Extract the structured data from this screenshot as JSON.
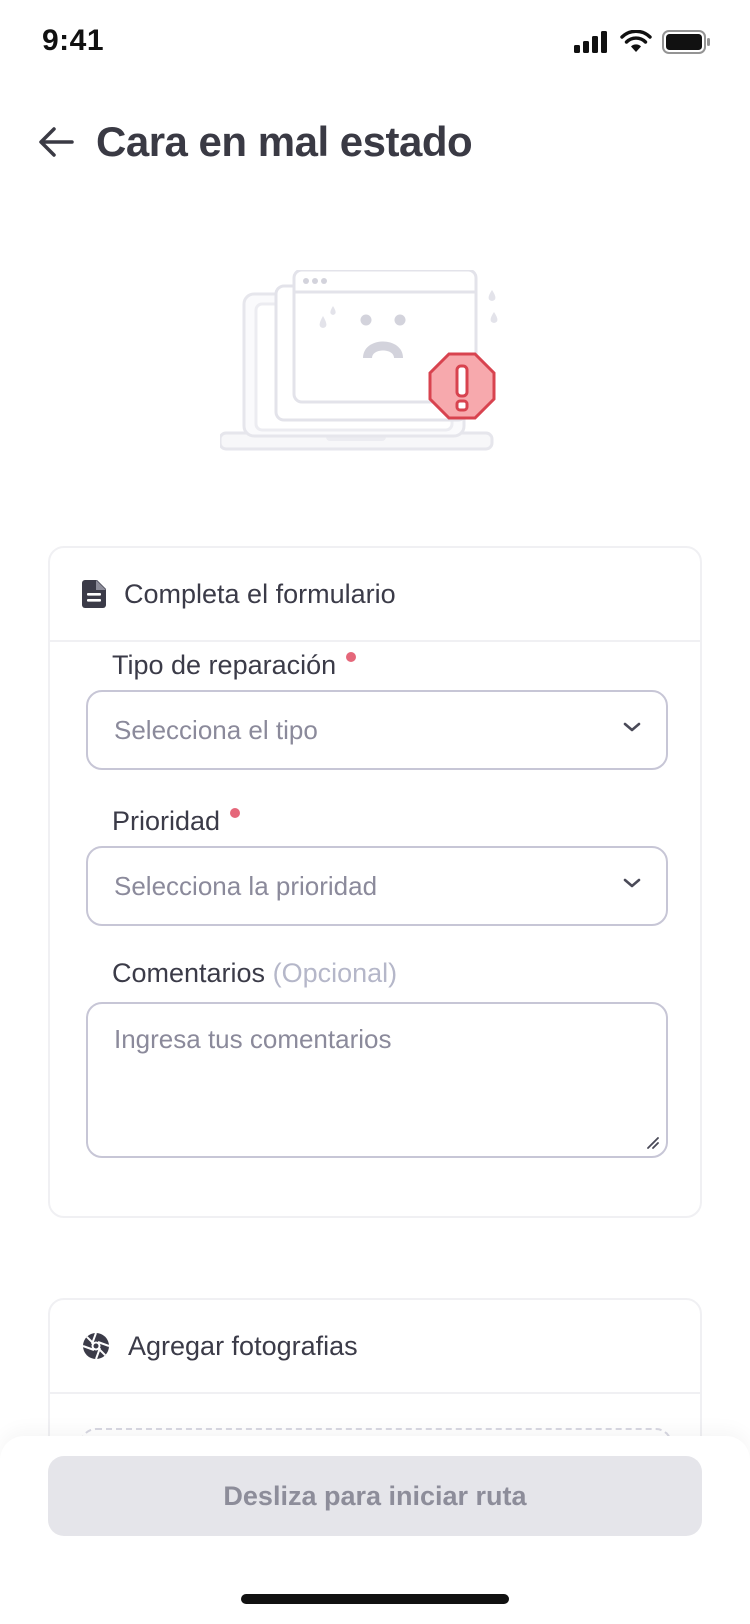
{
  "status_bar": {
    "time": "9:41"
  },
  "header": {
    "title": "Cara en mal estado"
  },
  "form_card": {
    "title": "Completa el formulario",
    "repair_type": {
      "label": "Tipo de reparación",
      "placeholder": "Selecciona el tipo"
    },
    "priority": {
      "label": "Prioridad",
      "placeholder": "Selecciona la prioridad"
    },
    "comments": {
      "label": "Comentarios",
      "optional": "(Opcional)",
      "placeholder": "Ingresa tus comentarios"
    }
  },
  "photo_card": {
    "title": "Agregar fotografias"
  },
  "footer": {
    "slide_label": "Desliza para iniciar ruta"
  },
  "colors": {
    "accent_required": "#e5677a",
    "alert_red": "#f7a9ad",
    "alert_border": "#d8434f"
  }
}
